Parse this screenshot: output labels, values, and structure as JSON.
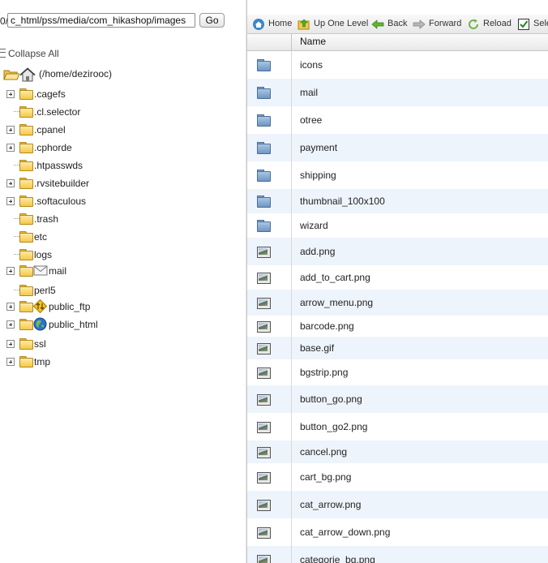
{
  "pathbar": {
    "prefix": "0/",
    "path_value": "c_html/pss/media/com_hikashop/images",
    "go_label": "Go"
  },
  "tree": {
    "collapse_all_label": "Collapse All",
    "root_label": "(/home/dezirooc)",
    "items": [
      {
        "label": ".cagefs",
        "expandable": true,
        "icon": "folder-icon"
      },
      {
        "label": ".cl.selector",
        "expandable": false,
        "icon": "folder-icon"
      },
      {
        "label": ".cpanel",
        "expandable": true,
        "icon": "folder-icon"
      },
      {
        "label": ".cphorde",
        "expandable": true,
        "icon": "folder-icon"
      },
      {
        "label": ".htpasswds",
        "expandable": false,
        "icon": "folder-icon"
      },
      {
        "label": ".rvsitebuilder",
        "expandable": true,
        "icon": "folder-icon"
      },
      {
        "label": ".softaculous",
        "expandable": true,
        "icon": "folder-icon"
      },
      {
        "label": ".trash",
        "expandable": false,
        "icon": "folder-icon"
      },
      {
        "label": "etc",
        "expandable": false,
        "icon": "folder-icon"
      },
      {
        "label": "logs",
        "expandable": false,
        "icon": "folder-icon"
      },
      {
        "label": "mail",
        "expandable": true,
        "icon": "mail-folder-icon"
      },
      {
        "label": "perl5",
        "expandable": false,
        "icon": "folder-icon"
      },
      {
        "label": "public_ftp",
        "expandable": true,
        "icon": "ftp-folder-icon"
      },
      {
        "label": "public_html",
        "expandable": true,
        "icon": "web-folder-icon"
      },
      {
        "label": "ssl",
        "expandable": true,
        "icon": "folder-icon"
      },
      {
        "label": "tmp",
        "expandable": true,
        "icon": "folder-icon"
      }
    ]
  },
  "toolbar": {
    "home_label": "Home",
    "up_label": "Up One Level",
    "back_label": "Back",
    "forward_label": "Forward",
    "reload_label": "Reload",
    "select_label": "Sele"
  },
  "file_list": {
    "name_header": "Name",
    "rows": [
      {
        "name": "icons",
        "type": "folder"
      },
      {
        "name": "mail",
        "type": "folder"
      },
      {
        "name": "otree",
        "type": "folder"
      },
      {
        "name": "payment",
        "type": "folder"
      },
      {
        "name": "shipping",
        "type": "folder"
      },
      {
        "name": "thumbnail_100x100",
        "type": "folder"
      },
      {
        "name": "wizard",
        "type": "folder"
      },
      {
        "name": "add.png",
        "type": "image"
      },
      {
        "name": "add_to_cart.png",
        "type": "image"
      },
      {
        "name": "arrow_menu.png",
        "type": "image"
      },
      {
        "name": "barcode.png",
        "type": "image"
      },
      {
        "name": "base.gif",
        "type": "image"
      },
      {
        "name": "bgstrip.png",
        "type": "image"
      },
      {
        "name": "button_go.png",
        "type": "image"
      },
      {
        "name": "button_go2.png",
        "type": "image"
      },
      {
        "name": "cancel.png",
        "type": "image"
      },
      {
        "name": "cart_bg.png",
        "type": "image"
      },
      {
        "name": "cat_arrow.png",
        "type": "image"
      },
      {
        "name": "cat_arrow_down.png",
        "type": "image"
      },
      {
        "name": "categorie_bg.png",
        "type": "image"
      }
    ]
  },
  "colors": {
    "alt_row": "#eef4fb",
    "folder_yellow": "#f4c94a",
    "folder_blue": "#6f96c2"
  }
}
